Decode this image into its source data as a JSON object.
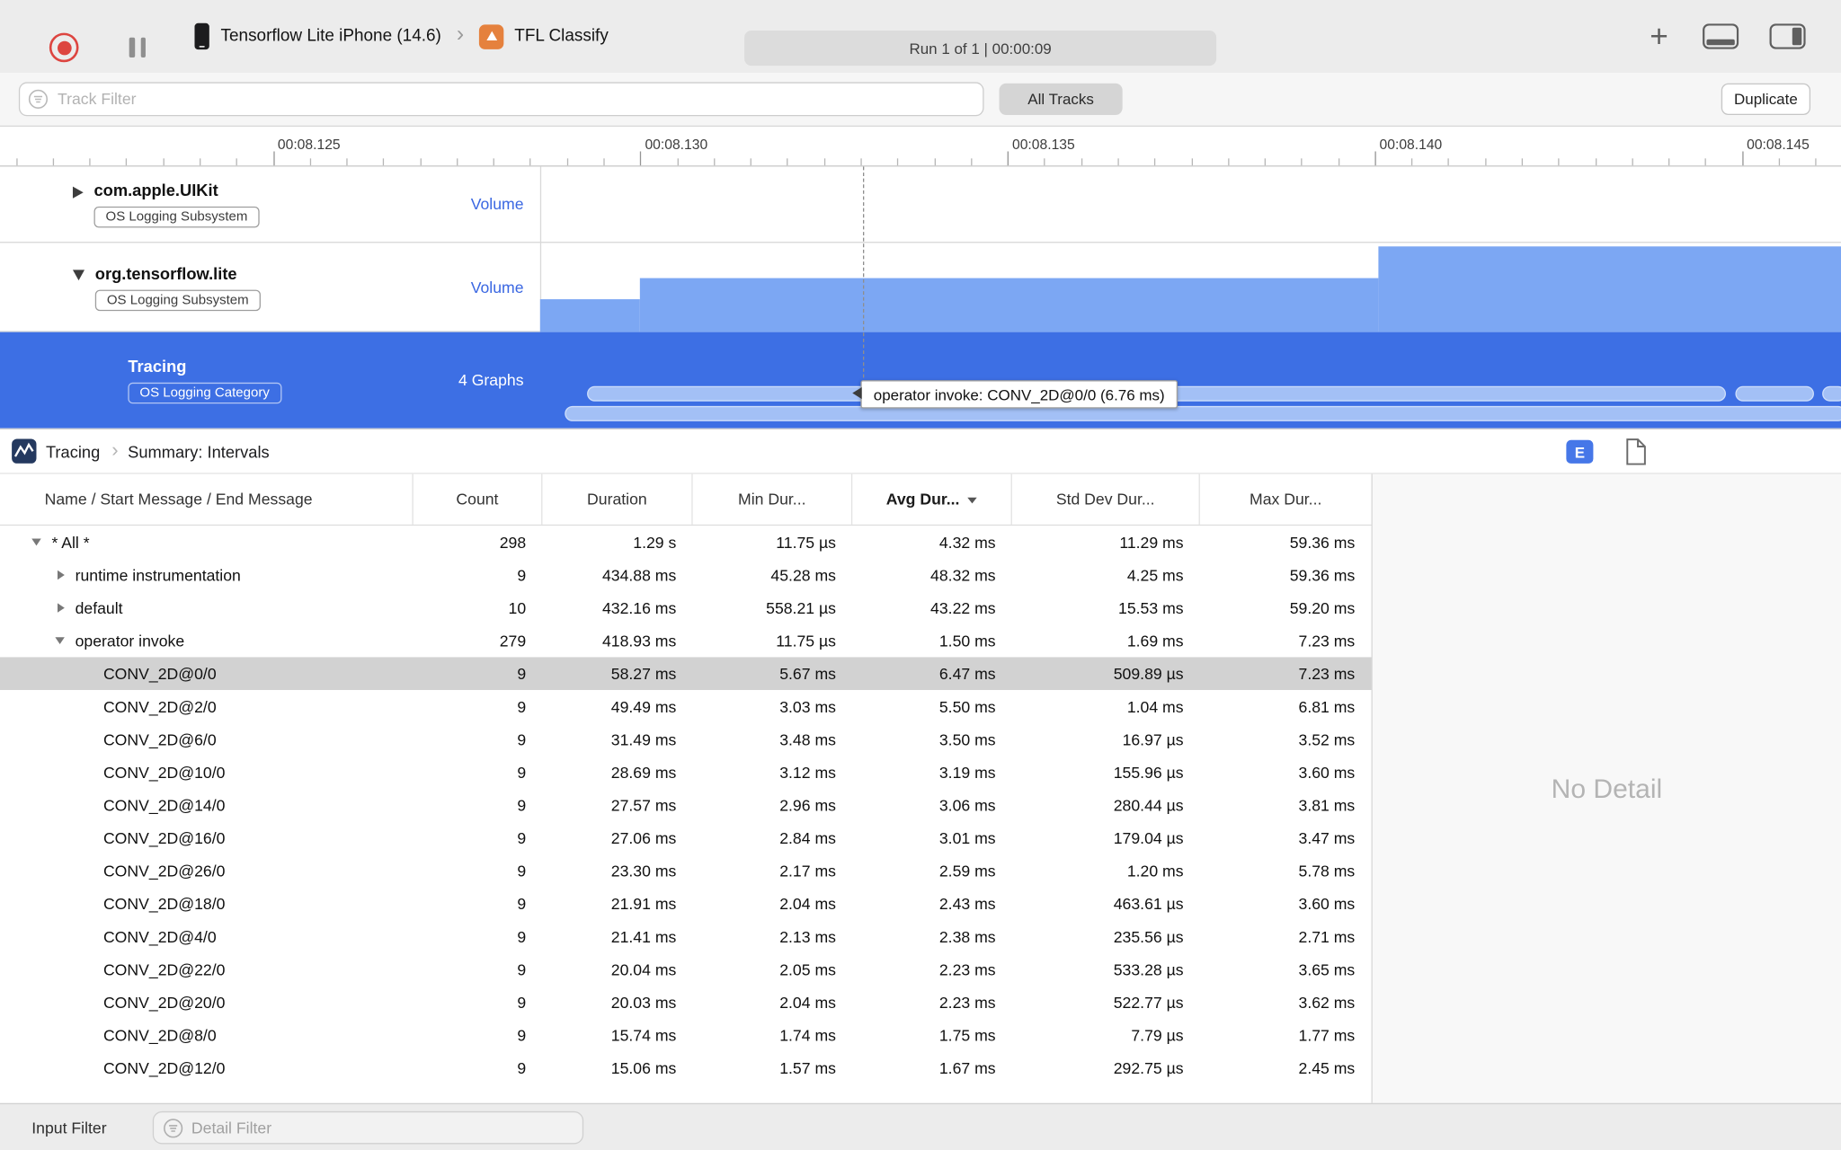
{
  "toolbar": {
    "device_name": "Tensorflow Lite iPhone (14.6)",
    "app_name": "TFL Classify",
    "run_status": "Run 1 of 1  |  00:00:09"
  },
  "filter_bar": {
    "track_filter_placeholder": "Track Filter",
    "all_tracks_label": "All Tracks",
    "duplicate_label": "Duplicate"
  },
  "ruler": {
    "labels": [
      "00:08.125",
      "00:08.130",
      "00:08.135",
      "00:08.140",
      "00:08.145"
    ]
  },
  "tracks": [
    {
      "title": "com.apple.UIKit",
      "badge": "OS Logging Subsystem",
      "meta": "Volume",
      "state": "collapsed"
    },
    {
      "title": "org.tensorflow.lite",
      "badge": "OS Logging Subsystem",
      "meta": "Volume",
      "state": "expanded"
    },
    {
      "title": "Tracing",
      "badge": "OS Logging Category",
      "meta": "4 Graphs",
      "state": "selected"
    }
  ],
  "timeline_tooltip": "operator invoke: CONV_2D@0/0 (6.76 ms)",
  "detail": {
    "breadcrumb": {
      "root": "Tracing",
      "page": "Summary: Intervals"
    },
    "columns": [
      "Name / Start Message / End Message",
      "Count",
      "Duration",
      "Min Dur...",
      "Avg Dur...",
      "Std Dev Dur...",
      "Max Dur..."
    ],
    "sort_column": "Avg Dur...",
    "no_detail_label": "No Detail",
    "rows": [
      {
        "name": "* All *",
        "level": 0,
        "disclosure": "open",
        "selected": false,
        "count": "298",
        "duration": "1.29 s",
        "min": "11.75 µs",
        "avg": "4.32 ms",
        "std": "11.29 ms",
        "max": "59.36 ms"
      },
      {
        "name": "runtime instrumentation",
        "level": 1,
        "disclosure": "closed",
        "selected": false,
        "count": "9",
        "duration": "434.88 ms",
        "min": "45.28 ms",
        "avg": "48.32 ms",
        "std": "4.25 ms",
        "max": "59.36 ms"
      },
      {
        "name": "default",
        "level": 1,
        "disclosure": "closed",
        "selected": false,
        "count": "10",
        "duration": "432.16 ms",
        "min": "558.21 µs",
        "avg": "43.22 ms",
        "std": "15.53 ms",
        "max": "59.20 ms"
      },
      {
        "name": "operator invoke",
        "level": 1,
        "disclosure": "open",
        "selected": false,
        "count": "279",
        "duration": "418.93 ms",
        "min": "11.75 µs",
        "avg": "1.50 ms",
        "std": "1.69 ms",
        "max": "7.23 ms"
      },
      {
        "name": "CONV_2D@0/0",
        "level": 2,
        "disclosure": null,
        "selected": true,
        "count": "9",
        "duration": "58.27 ms",
        "min": "5.67 ms",
        "avg": "6.47 ms",
        "std": "509.89 µs",
        "max": "7.23 ms"
      },
      {
        "name": "CONV_2D@2/0",
        "level": 2,
        "disclosure": null,
        "selected": false,
        "count": "9",
        "duration": "49.49 ms",
        "min": "3.03 ms",
        "avg": "5.50 ms",
        "std": "1.04 ms",
        "max": "6.81 ms"
      },
      {
        "name": "CONV_2D@6/0",
        "level": 2,
        "disclosure": null,
        "selected": false,
        "count": "9",
        "duration": "31.49 ms",
        "min": "3.48 ms",
        "avg": "3.50 ms",
        "std": "16.97 µs",
        "max": "3.52 ms"
      },
      {
        "name": "CONV_2D@10/0",
        "level": 2,
        "disclosure": null,
        "selected": false,
        "count": "9",
        "duration": "28.69 ms",
        "min": "3.12 ms",
        "avg": "3.19 ms",
        "std": "155.96 µs",
        "max": "3.60 ms"
      },
      {
        "name": "CONV_2D@14/0",
        "level": 2,
        "disclosure": null,
        "selected": false,
        "count": "9",
        "duration": "27.57 ms",
        "min": "2.96 ms",
        "avg": "3.06 ms",
        "std": "280.44 µs",
        "max": "3.81 ms"
      },
      {
        "name": "CONV_2D@16/0",
        "level": 2,
        "disclosure": null,
        "selected": false,
        "count": "9",
        "duration": "27.06 ms",
        "min": "2.84 ms",
        "avg": "3.01 ms",
        "std": "179.04 µs",
        "max": "3.47 ms"
      },
      {
        "name": "CONV_2D@26/0",
        "level": 2,
        "disclosure": null,
        "selected": false,
        "count": "9",
        "duration": "23.30 ms",
        "min": "2.17 ms",
        "avg": "2.59 ms",
        "std": "1.20 ms",
        "max": "5.78 ms"
      },
      {
        "name": "CONV_2D@18/0",
        "level": 2,
        "disclosure": null,
        "selected": false,
        "count": "9",
        "duration": "21.91 ms",
        "min": "2.04 ms",
        "avg": "2.43 ms",
        "std": "463.61 µs",
        "max": "3.60 ms"
      },
      {
        "name": "CONV_2D@4/0",
        "level": 2,
        "disclosure": null,
        "selected": false,
        "count": "9",
        "duration": "21.41 ms",
        "min": "2.13 ms",
        "avg": "2.38 ms",
        "std": "235.56 µs",
        "max": "2.71 ms"
      },
      {
        "name": "CONV_2D@22/0",
        "level": 2,
        "disclosure": null,
        "selected": false,
        "count": "9",
        "duration": "20.04 ms",
        "min": "2.05 ms",
        "avg": "2.23 ms",
        "std": "533.28 µs",
        "max": "3.65 ms"
      },
      {
        "name": "CONV_2D@20/0",
        "level": 2,
        "disclosure": null,
        "selected": false,
        "count": "9",
        "duration": "20.03 ms",
        "min": "2.04 ms",
        "avg": "2.23 ms",
        "std": "522.77 µs",
        "max": "3.62 ms"
      },
      {
        "name": "CONV_2D@8/0",
        "level": 2,
        "disclosure": null,
        "selected": false,
        "count": "9",
        "duration": "15.74 ms",
        "min": "1.74 ms",
        "avg": "1.75 ms",
        "std": "7.79 µs",
        "max": "1.77 ms"
      },
      {
        "name": "CONV_2D@12/0",
        "level": 2,
        "disclosure": null,
        "selected": false,
        "count": "9",
        "duration": "15.06 ms",
        "min": "1.57 ms",
        "avg": "1.67 ms",
        "std": "292.75 µs",
        "max": "2.45 ms"
      }
    ]
  },
  "bottom_bar": {
    "input_filter_label": "Input Filter",
    "detail_filter_placeholder": "Detail Filter"
  },
  "colors": {
    "selection_blue": "#3d6fe4",
    "volume_blue": "#7ca7f3",
    "interval_pill_blue": "#a3c0f6",
    "meta_text_blue": "#3a67e2",
    "record_red": "#dd4540"
  }
}
